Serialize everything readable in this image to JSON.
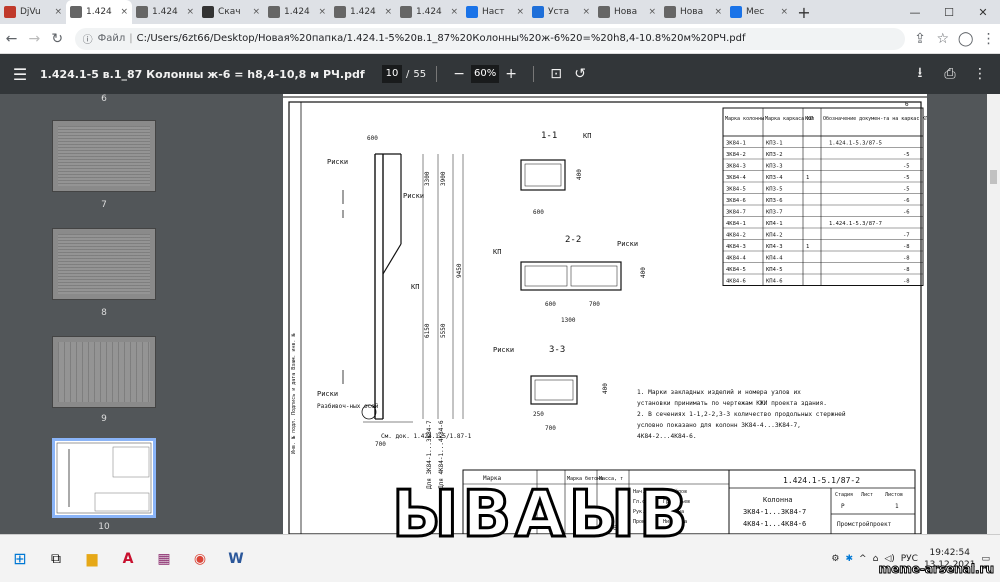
{
  "tabs": [
    {
      "label": "DjVu",
      "icon": "djvu-icon",
      "color": "#c0392b",
      "active": false
    },
    {
      "label": "1.424",
      "icon": "globe-icon",
      "color": "#666",
      "active": true
    },
    {
      "label": "1.424",
      "icon": "globe-icon",
      "color": "#666",
      "active": false
    },
    {
      "label": "Скач",
      "icon": "hammer-sickle-icon",
      "color": "#333",
      "active": false
    },
    {
      "label": "1.424",
      "icon": "globe-icon",
      "color": "#666",
      "active": false
    },
    {
      "label": "1.424",
      "icon": "globe-icon",
      "color": "#666",
      "active": false
    },
    {
      "label": "1.424",
      "icon": "globe-icon",
      "color": "#666",
      "active": false
    },
    {
      "label": "Наст",
      "icon": "gear-icon",
      "color": "#1a73e8",
      "active": false
    },
    {
      "label": "Уста",
      "icon": "w3-icon",
      "color": "#1e6fd9",
      "active": false
    },
    {
      "label": "Нова",
      "icon": "globe-icon",
      "color": "#666",
      "active": false
    },
    {
      "label": "Нова",
      "icon": "globe-icon",
      "color": "#666",
      "active": false
    },
    {
      "label": "Мес",
      "icon": "messenger-icon",
      "color": "#1a73e8",
      "active": false
    }
  ],
  "address": {
    "prefix": "Файл",
    "url": "C:/Users/6zt66/Desktop/Новая%20папка/1.424.1-5%20в.1_87%20Колонны%20ж-6%20=%20h8,4-10.8%20м%20РЧ.pdf"
  },
  "pdf": {
    "title": "1.424.1-5 в.1_87 Колонны ж-6 = h8,4-10,8 м РЧ.pdf",
    "current_page": "10",
    "total_pages": "55",
    "zoom": "60%"
  },
  "thumbnails": [
    {
      "label": "6"
    },
    {
      "label": "7"
    },
    {
      "label": "8"
    },
    {
      "label": "9"
    },
    {
      "label": "10"
    }
  ],
  "drawing": {
    "table_headers": [
      "Марка колонны",
      "Марка каркаса КП",
      "Кол",
      "Обозначение докумен-та на каркас КП"
    ],
    "rows": [
      [
        "3К84-1",
        "КП3-1",
        "",
        "1.424.1-5.3/87-5"
      ],
      [
        "3К84-2",
        "КП3-2",
        "",
        "-5"
      ],
      [
        "3К84-3",
        "КП3-3",
        "",
        "-5"
      ],
      [
        "3К84-4",
        "КП3-4",
        "1",
        "-5"
      ],
      [
        "3К84-5",
        "КП3-5",
        "",
        "-5"
      ],
      [
        "3К84-6",
        "КП3-6",
        "",
        "-6"
      ],
      [
        "3К84-7",
        "КП3-7",
        "",
        "-6"
      ],
      [
        "4К84-1",
        "КП4-1",
        "",
        "1.424.1-5.3/87-7"
      ],
      [
        "4К84-2",
        "КП4-2",
        "",
        "-7"
      ],
      [
        "4К84-3",
        "КП4-3",
        "1",
        "-8"
      ],
      [
        "4К84-4",
        "КП4-4",
        "",
        "-8"
      ],
      [
        "4К84-5",
        "КП4-5",
        "",
        "-8"
      ],
      [
        "4К84-6",
        "КП4-6",
        "",
        "-8"
      ]
    ],
    "section_labels": [
      "1-1",
      "2-2",
      "3-3"
    ],
    "labels": {
      "kp": "КП",
      "riski": "Риски",
      "razbivochnye": "Разбивоч-ных осей",
      "see_doc": "См. док. 1.424.1-5/1.87-1",
      "for_3k": "Для 3К84-1...3К84-7",
      "for_4k": "Для 4К84-1...4К84-6"
    },
    "dims": [
      "600",
      "700",
      "1300",
      "400",
      "250",
      "3300",
      "3900",
      "9450",
      "6150",
      "5550",
      "900",
      "450",
      "100"
    ],
    "notes": [
      "1. Марки закладных изделий и номера узлов их",
      "установки принимать по чертежам КЖИ проекта здания.",
      "2. В сечениях 1-1,2-2,3-3 количество продольных стержней",
      "условно показано для колонн 3К84-4...3К84-7,",
      "4К84-2...4К84-6."
    ],
    "stamp_code": "1.424.1-5.1/87-2",
    "stamp_title": "Колонна",
    "stamp_sub1": "3К84-1...3К84-7",
    "stamp_sub2": "4К84-1...4К84-6",
    "stamp_org": "Промстройпроект",
    "stamp_cols": [
      "Стадия",
      "Лист",
      "Листов"
    ],
    "stamp_vals": [
      "Р",
      "",
      "1"
    ],
    "stamp_people": [
      "Нач.отд",
      "Гл.спец",
      "Рук.бр",
      "Проверил"
    ],
    "stamp_names": [
      "Михайлов",
      "Григорьев",
      "Акишина",
      "Никонова"
    ],
    "mark_headers": [
      "Марка",
      "Марка бетона",
      "Масса, т"
    ],
    "sheet_no": "6"
  },
  "taskbar": {
    "lang": "РУС",
    "time": "19:42:54",
    "date": "13.12.2021"
  },
  "meme_caption": "ЫВАЫВ",
  "watermark": "meme-arsenal.ru"
}
